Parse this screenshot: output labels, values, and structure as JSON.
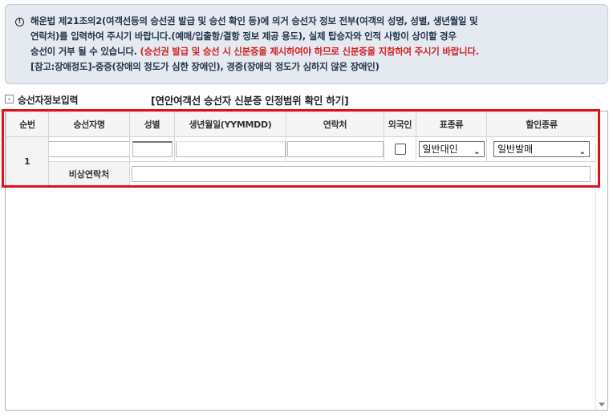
{
  "notice": {
    "line1": "해운법 제21조의2(여객선등의 승선권 발급 및 승선 확인 등)에 의거 승선자 정보 전부(여객의 성명, 성별, 생년월일 및",
    "line2": "연락처)를 입력하여 주시기 바랍니다.(예매/입출항/결항 정보 제공 용도), 실제 탑승자와 인적 사항이 상이할 경우",
    "line3_plain": "승선이 거부 될 수 있습니다.",
    "line3_red": "(승선권 발급 및 승선 시 신분증을 제시하여야 하므로 신분증을 지참하여 주시기 바랍니다.",
    "line4": "[참고:장애정도]-중증(장애의 정도가 심한 장애인), 경증(장애의 정도가 심하지 않은 장애인)"
  },
  "section": {
    "title": "승선자정보입력",
    "link": "[연안여객선 승선자 신분증 인정범위 확인 하기]"
  },
  "table": {
    "headers": [
      "순번",
      "승선자명",
      "성별",
      "생년월일(YYMMDD)",
      "연락처",
      "외국인",
      "표종류",
      "할인종류"
    ],
    "row": {
      "number": "1",
      "name": "",
      "gender": "",
      "birthdate": "",
      "phone": "",
      "ticket_type": "일반대인",
      "discount_type": "일반발매",
      "emergency_label": "비상연락처",
      "emergency_value": ""
    }
  },
  "colors": {
    "highlight_border": "#e0101a",
    "notice_bg": "#e5eaf1",
    "warning_text": "#d22222"
  }
}
